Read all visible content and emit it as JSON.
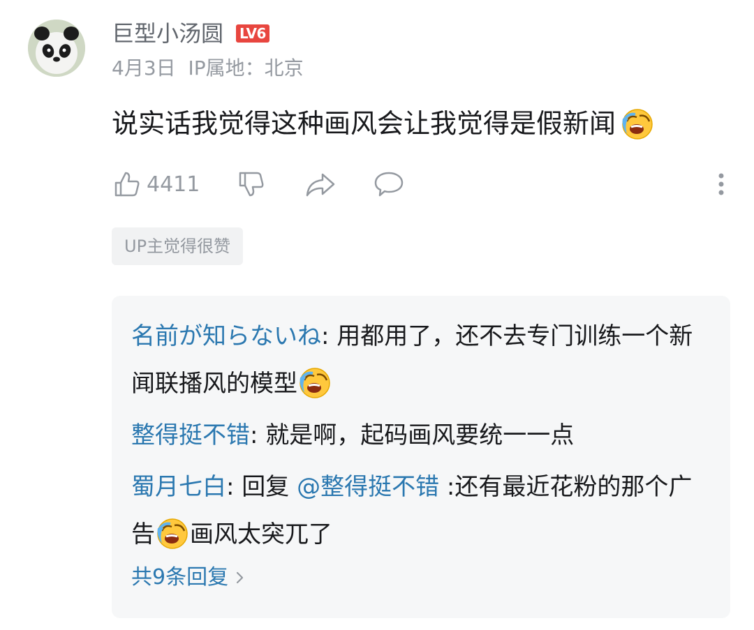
{
  "comment": {
    "username": "巨型小汤圆",
    "level": "LV6",
    "date": "4月3日",
    "ip": "IP属地：北京",
    "text": "说实话我觉得这种画风会让我觉得是假新闻",
    "emoji": "laugh-cry-emoji",
    "likes": "4411",
    "up_tag": "UP主觉得很赞"
  },
  "replies": [
    {
      "name": "名前が知らないね",
      "sep": ": ",
      "text1": "用都用了，还不去专门训练一个新闻联播风的模型",
      "emoji": "laugh-cry-emoji"
    },
    {
      "name": "整得挺不错",
      "sep": ": ",
      "text1": "就是啊，起码画风要统一一点"
    },
    {
      "name": "蜀月七白",
      "sep": ": ",
      "prefix": "回复 ",
      "mention": "@整得挺不错",
      "text1": " :还有最近花粉的那个广告",
      "emoji": "laugh-cry-emoji",
      "text2": "画风太突兀了"
    }
  ],
  "more_replies": "共9条回复",
  "colors": {
    "link": "#2b78b0",
    "level_badge": "#e8463f",
    "muted": "#9499a0"
  }
}
